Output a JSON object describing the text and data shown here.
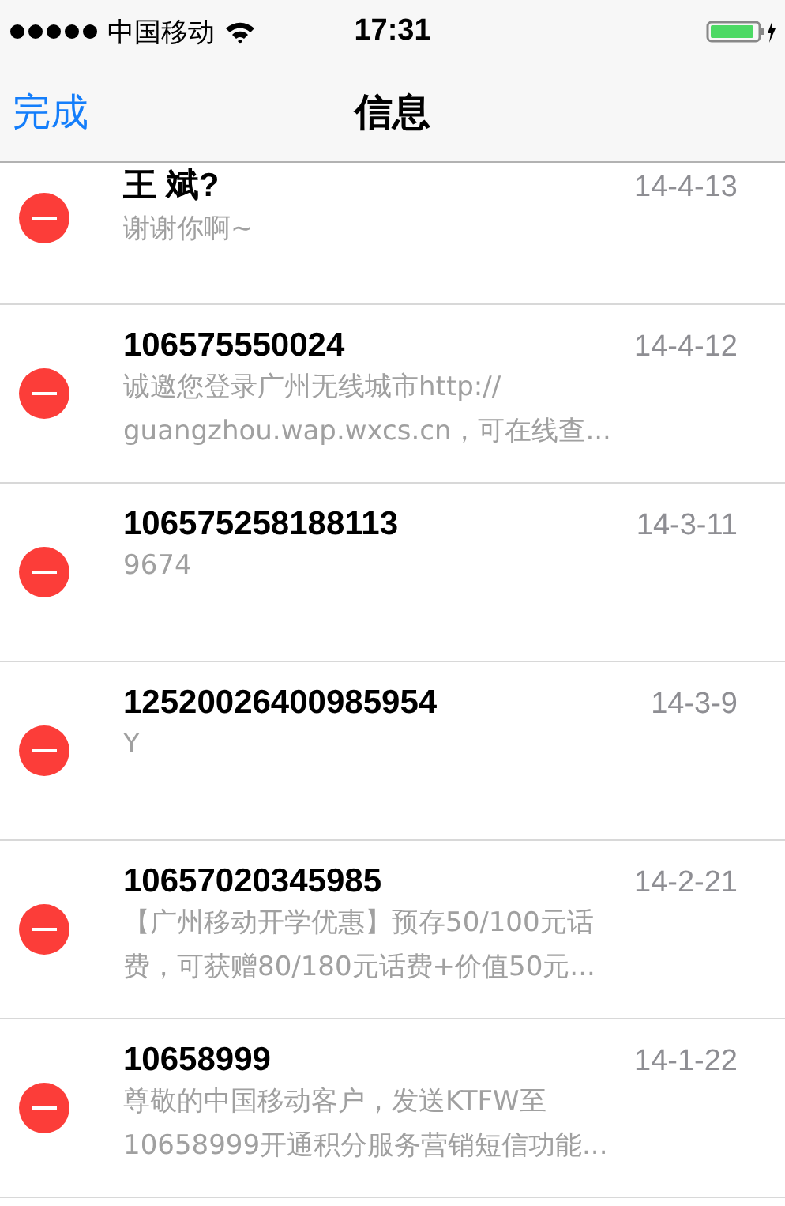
{
  "status_bar": {
    "carrier": "中国移动",
    "time": "17:31"
  },
  "nav": {
    "done": "完成",
    "title": "信息"
  },
  "messages": [
    {
      "sender": "王 斌?",
      "date": "14-4-13",
      "preview": [
        "谢谢你啊~"
      ]
    },
    {
      "sender": "106575550024",
      "date": "14-4-12",
      "preview": [
        "诚邀您登录广州无线城市http://",
        "guangzhou.wap.wxcs.cn，可在线查..."
      ]
    },
    {
      "sender": "106575258188113",
      "date": "14-3-11",
      "preview": [
        "9674"
      ]
    },
    {
      "sender": "12520026400985954",
      "date": "14-3-9",
      "preview": [
        "Y"
      ]
    },
    {
      "sender": "10657020345985",
      "date": "14-2-21",
      "preview": [
        "【广州移动开学优惠】预存50/100元话",
        "费，可获赠80/180元话费+价值50元..."
      ]
    },
    {
      "sender": "10658999",
      "date": "14-1-22",
      "preview": [
        "尊敬的中国移动客户，发送KTFW至",
        "10658999开通积分服务营销短信功能..."
      ]
    }
  ]
}
